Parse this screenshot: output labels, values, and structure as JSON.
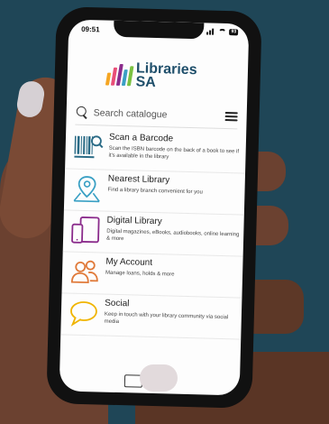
{
  "status_bar": {
    "time": "09:51",
    "battery": "93"
  },
  "logo": {
    "line1": "Libraries",
    "line2": "SA"
  },
  "search": {
    "placeholder": "Search catalogue"
  },
  "menu": [
    {
      "title": "Scan a Barcode",
      "desc": "Scan the ISBN barcode on the back of a book to see if it's available in the library",
      "icon": "barcode-scan-icon",
      "color": "#2a6b86"
    },
    {
      "title": "Nearest Library",
      "desc": "Find a library branch convenient for you",
      "icon": "location-pin-icon",
      "color": "#3aa0c4"
    },
    {
      "title": "Digital Library",
      "desc": "Digital magazines, eBooks, audiobooks, online learning & more",
      "icon": "devices-icon",
      "color": "#8b2c8c"
    },
    {
      "title": "My Account",
      "desc": "Manage loans, holds & more",
      "icon": "users-icon",
      "color": "#e07a3a"
    },
    {
      "title": "Social",
      "desc": "Keep in touch with your library community via social media",
      "icon": "chat-bubble-icon",
      "color": "#f0b400"
    }
  ],
  "colors": {
    "background": "#1f4657",
    "logo_text": "#1f4f6b",
    "logo_bars": [
      "#f5a623",
      "#e94e77",
      "#8b2c8c",
      "#3aa0c4",
      "#7ac142"
    ]
  }
}
